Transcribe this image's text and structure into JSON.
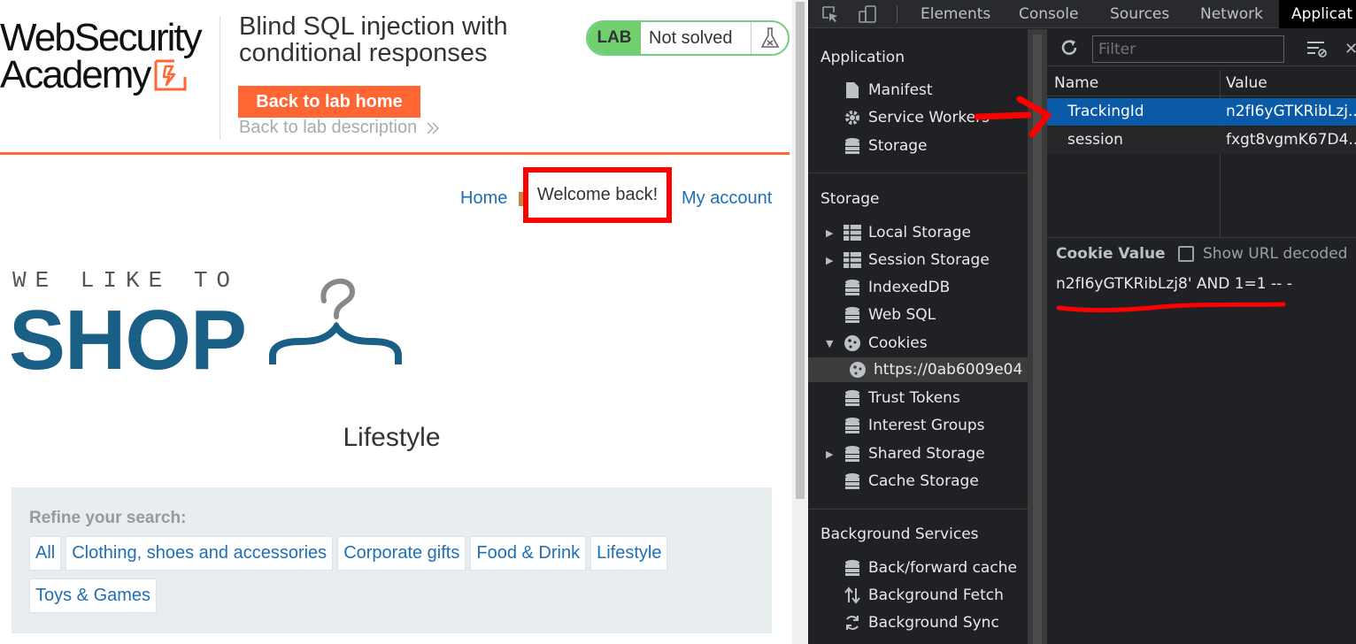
{
  "page": {
    "logo": {
      "line1": "WebSecurity",
      "line2": "Academy"
    },
    "lab_title": "Blind SQL injection with conditional responses",
    "back_to_lab_home": "Back to lab home",
    "back_to_lab_description": "Back to lab description",
    "back_desc_icon": "double-chevron-right-icon",
    "lab_badge": {
      "tag": "LAB",
      "status": "Not solved",
      "icon": "flask-icon"
    },
    "nav": {
      "home": "Home",
      "welcome": "Welcome back!",
      "account": "My account"
    },
    "shop_logo": {
      "small": "WE LIKE TO",
      "big": "SHOP",
      "icon": "hanger-icon"
    },
    "category_title": "Lifestyle",
    "filter": {
      "label": "Refine your search:",
      "tags": [
        "All",
        "Clothing, shoes and accessories",
        "Corporate gifts",
        "Food & Drink",
        "Lifestyle",
        "Toys & Games"
      ]
    },
    "colors": {
      "accent": "#ff6633",
      "link": "#1e6fb6",
      "shop_blue": "#1a5f86",
      "lab_green": "#70d070",
      "annotation_red": "#ff0000"
    }
  },
  "devtools": {
    "tabs": [
      "Elements",
      "Console",
      "Sources",
      "Network",
      "Applicat"
    ],
    "active_tab": "Applicat",
    "tab_icons": [
      "inspect-element-icon",
      "device-toolbar-icon"
    ],
    "sidebar": {
      "application_header": "Application",
      "application_items": [
        "Manifest",
        "Service Workers",
        "Storage"
      ],
      "storage_header": "Storage",
      "storage_items": [
        "Local Storage",
        "Session Storage",
        "IndexedDB",
        "Web SQL",
        "Cookies"
      ],
      "cookie_origin": "https://0ab6009e04",
      "storage_items_2": [
        "Trust Tokens",
        "Interest Groups",
        "Shared Storage",
        "Cache Storage"
      ],
      "background_header": "Background Services",
      "background_items": [
        "Back/forward cache",
        "Background Fetch",
        "Background Sync"
      ]
    },
    "toolbar": {
      "filter_placeholder": "Filter",
      "icons": [
        "refresh-icon",
        "clear-filtered-icon",
        "close-icon"
      ]
    },
    "cookies_table": {
      "columns": [
        "Name",
        "Value"
      ],
      "rows": [
        {
          "name": "TrackingId",
          "value": "n2fI6yGTKRibLzj..."
        },
        {
          "name": "session",
          "value": "fxgt8vgmK67D4..."
        }
      ],
      "selected_row": 0
    },
    "cookie_value": {
      "header": "Cookie Value",
      "show_url_decoded": "Show URL decoded",
      "value": "n2fI6yGTKRibLzj8' AND 1=1 -- -"
    },
    "colors": {
      "bg": "#202124",
      "selected_row": "#0b5aa8"
    }
  }
}
